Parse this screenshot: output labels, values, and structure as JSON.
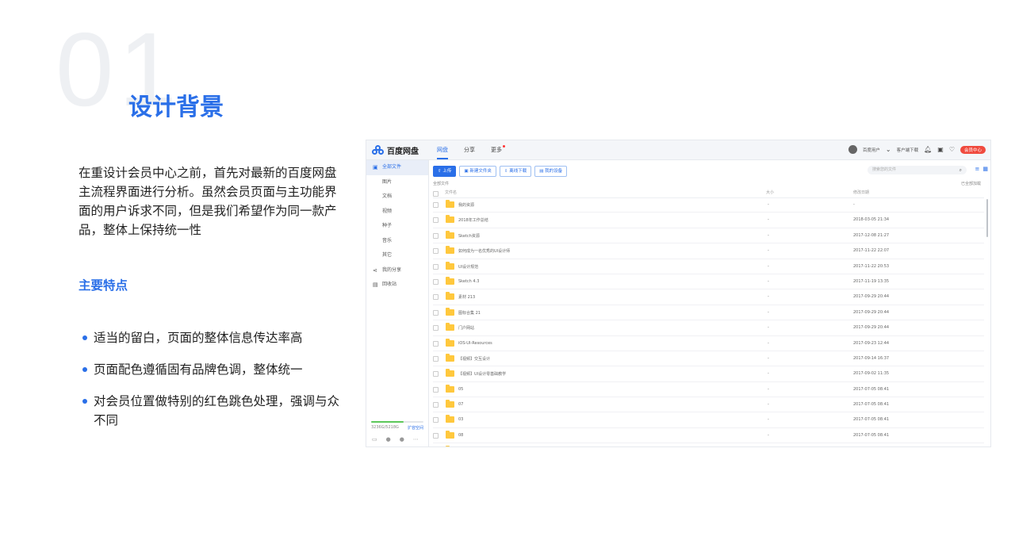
{
  "slide": {
    "number": "01",
    "title": "设计背景",
    "intro": "在重设计会员中心之前，首先对最新的百度网盘主流程界面进行分析。虽然会员页面与主功能界面的用户诉求不同，但是我们希望作为同一款产品，整体上保持统一性",
    "features_title": "主要特点",
    "features": [
      "适当的留白，页面的整体信息传达率高",
      "页面配色遵循固有品牌色调，整体统一",
      "对会员位置做特别的红色跳色处理，强调与众不同"
    ],
    "accent_color": "#2a6fe8"
  },
  "app": {
    "logo": "百度网盘",
    "nav": [
      "网盘",
      "分享",
      "更多"
    ],
    "user": {
      "name": "百度用户",
      "client_download": "客户端下载",
      "member_button": "会员中心",
      "member_color": "#f04a3e"
    },
    "sidebar": {
      "items": [
        "全部文件",
        "图片",
        "文档",
        "视频",
        "种子",
        "音乐",
        "其它",
        "我的分享",
        "回收站"
      ],
      "quota": "3236G/5218G",
      "quota_fraction": 0.62,
      "expand": "扩容空间"
    },
    "toolbar": {
      "upload": "上传",
      "new_folder": "新建文件夹",
      "offline": "离线下载",
      "devices": "我的设备"
    },
    "search_placeholder": "搜索您的文件",
    "breadcrumb": "全部文件",
    "loaded": "已全部加载",
    "columns": {
      "name": "文件名",
      "size": "大小",
      "date": "修改日期"
    },
    "files": [
      {
        "name": "我的资源",
        "size": "-",
        "date": "-"
      },
      {
        "name": "2018年工作总结",
        "size": "-",
        "date": "2018-03-05 21:34"
      },
      {
        "name": "Sketch资源",
        "size": "-",
        "date": "2017-12-08 21:27"
      },
      {
        "name": "如何成为一名优秀的UI设计师",
        "size": "-",
        "date": "2017-11-22 22:07"
      },
      {
        "name": "UI设计规范",
        "size": "-",
        "date": "2017-11-22 20:53"
      },
      {
        "name": "Sketch 4.3",
        "size": "-",
        "date": "2017-11-19 13:35"
      },
      {
        "name": "素材 213",
        "size": "-",
        "date": "2017-09-29 20:44"
      },
      {
        "name": "图标合集 21",
        "size": "-",
        "date": "2017-09-29 20:44"
      },
      {
        "name": "门户网站",
        "size": "-",
        "date": "2017-09-29 20:44"
      },
      {
        "name": "iOS-UI-Resources",
        "size": "-",
        "date": "2017-09-23 12:44"
      },
      {
        "name": "【视频】交互设计",
        "size": "-",
        "date": "2017-09-14 16:37"
      },
      {
        "name": "【视频】UI设计零基础教学",
        "size": "-",
        "date": "2017-09-02 11:35"
      },
      {
        "name": "05",
        "size": "-",
        "date": "2017-07-05 08:41"
      },
      {
        "name": "07",
        "size": "-",
        "date": "2017-07-05 08:41"
      },
      {
        "name": "03",
        "size": "-",
        "date": "2017-07-05 08:41"
      },
      {
        "name": "08",
        "size": "-",
        "date": "2017-07-05 08:41"
      },
      {
        "name": "07",
        "size": "-",
        "date": "2017-07-05 08:44"
      }
    ]
  }
}
